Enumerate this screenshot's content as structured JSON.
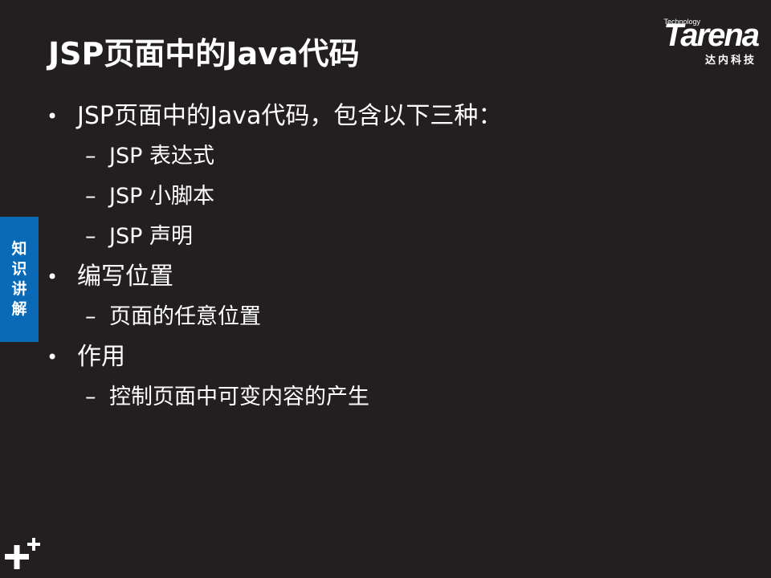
{
  "slide": {
    "title": "JSP页面中的Java代码",
    "side_tab": [
      "知",
      "识",
      "讲",
      "解"
    ],
    "logo": {
      "small": "Technology",
      "word": "Tarena",
      "sub": "达内科技"
    },
    "bullets": [
      {
        "text": "JSP页面中的Java代码，包含以下三种：",
        "subs": [
          "JSP 表达式",
          "JSP 小脚本",
          "JSP 声明"
        ]
      },
      {
        "text": "编写位置",
        "subs": [
          "页面的任意位置"
        ]
      },
      {
        "text": "作用",
        "subs": [
          "控制页面中可变内容的产生"
        ]
      }
    ],
    "bullet_glyph": "•",
    "dash_glyph": "–"
  },
  "colors": {
    "background": "#231f20",
    "text": "#ffffff",
    "side_tab": "#0a6ab8"
  },
  "icons": [
    "plus-logo-icon"
  ]
}
